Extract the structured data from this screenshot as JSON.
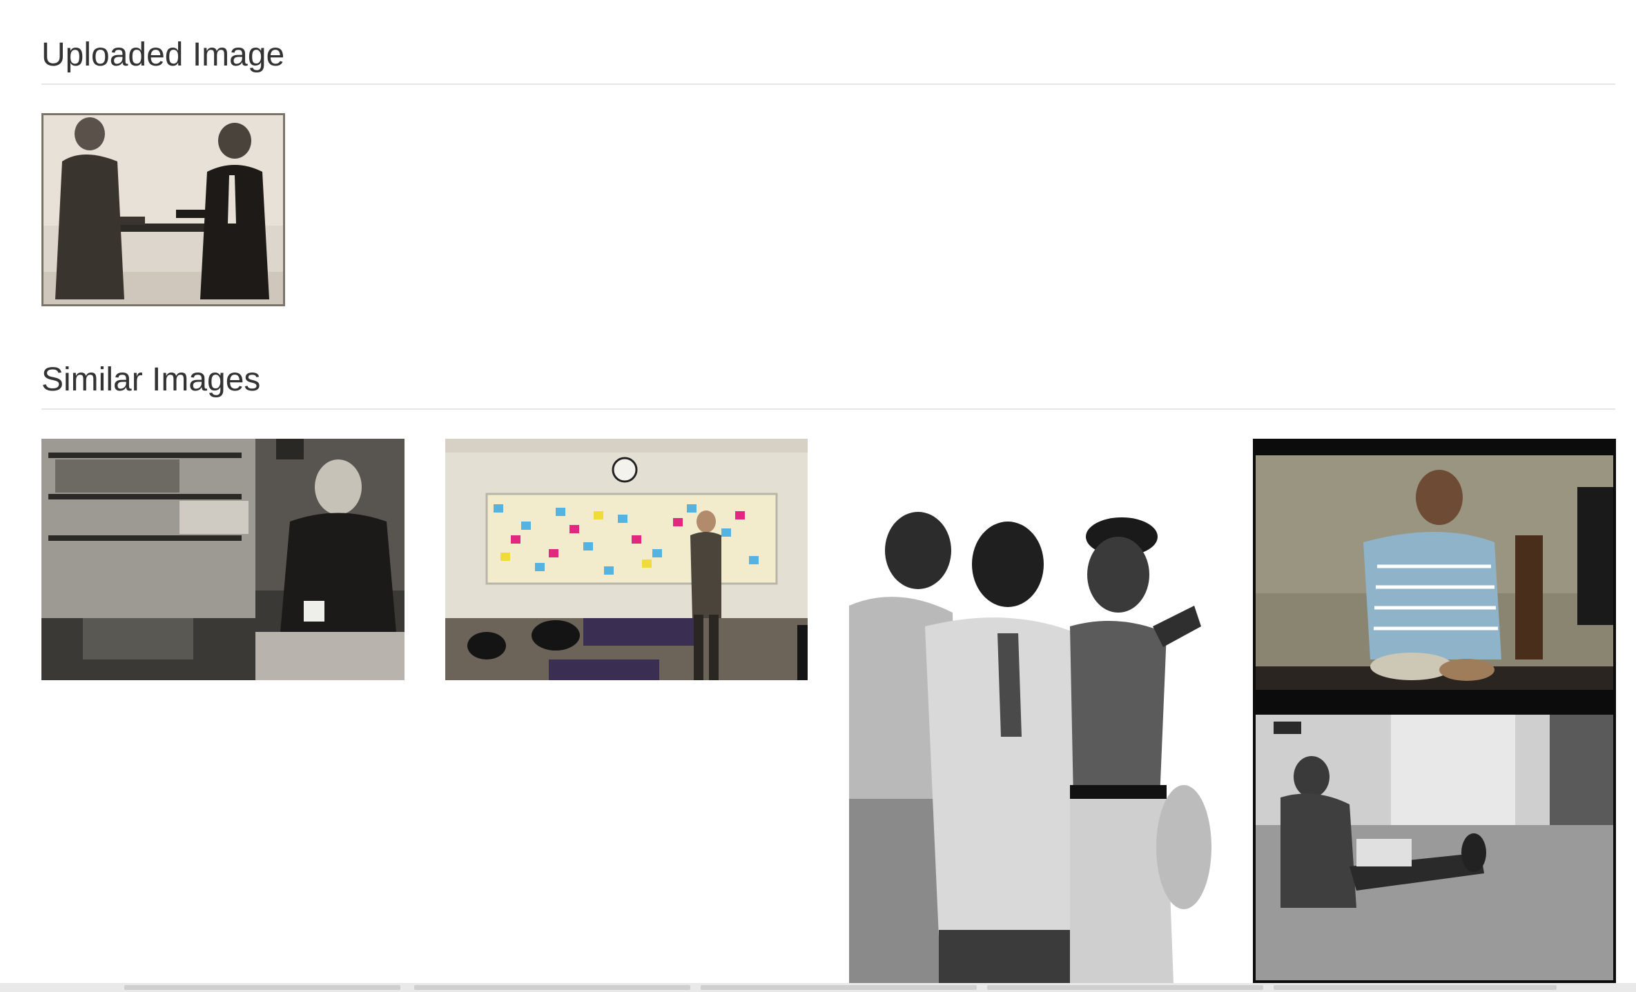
{
  "uploaded": {
    "heading": "Uploaded Image",
    "image_label": "two men shaking hands photo"
  },
  "similar": {
    "heading": "Similar Images",
    "images": [
      {
        "label": "elderly man with mug photo"
      },
      {
        "label": "sticky note wall photo"
      },
      {
        "label": "three men embracing photo"
      },
      {
        "label": "man talking and sitting woman photo"
      }
    ]
  }
}
